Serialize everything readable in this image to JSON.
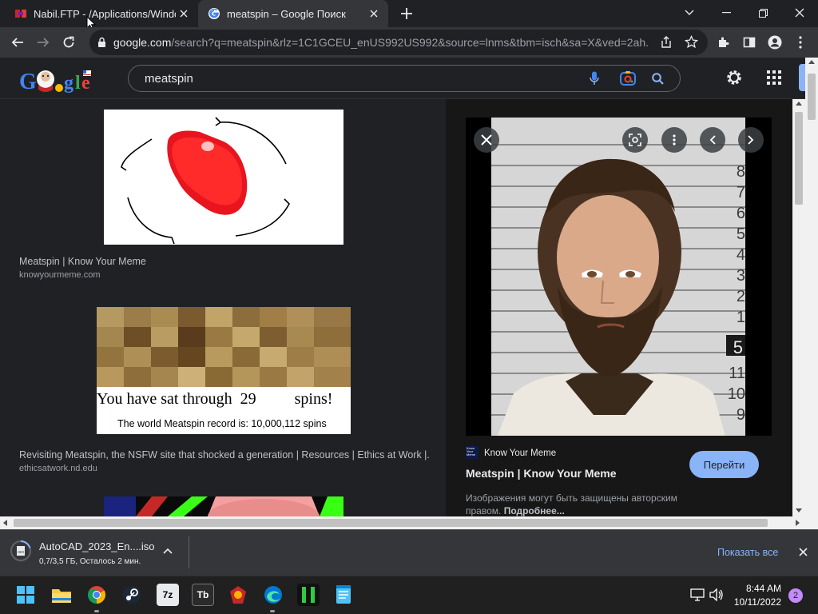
{
  "browser": {
    "tabs": [
      {
        "title": "Nabil.FTP - /Applications/Windows",
        "favicon": "ftp-icon"
      },
      {
        "title": "meatspin – Google Поиск",
        "favicon": "google-icon",
        "active": true
      }
    ],
    "url_host": "google.com",
    "url_rest": "/search?q=meatspin&rlz=1C1GCEU_enUS992US992&source=lnms&tbm=isch&sa=X&ved=2ah..."
  },
  "search": {
    "query": "meatspin"
  },
  "results": [
    {
      "title": "Meatspin | Know Your Meme",
      "source": "knowyourmeme.com"
    },
    {
      "title": "Revisiting Meatspin, the NSFW site that shocked a generation | Resources | Ethics at Work |...",
      "source": "ethicsatwork.nd.edu",
      "image_text_line1": "You have sat through",
      "image_text_count": "29",
      "image_text_suffix": "spins!",
      "image_text_line2": "The world Meatspin record is: 10,000,112 spins"
    }
  ],
  "panel": {
    "source_name": "Know Your Meme",
    "source_logo_text": "Know Your Meme",
    "title": "Meatspin | Know Your Meme",
    "visit_label": "Перейти",
    "copyright_text": "Изображения могут быть защищены авторским правом.",
    "copyright_more": "Подробнее...",
    "mugshot_height_marks": [
      "8",
      "7",
      "6",
      "5",
      "4",
      "3",
      "2",
      "1",
      "5",
      "11",
      "10",
      "9"
    ]
  },
  "download": {
    "filename": "AutoCAD_2023_En....iso",
    "progress_text": "0,7/3,5 ГБ, Осталось 2 мин.",
    "progress": 0.2,
    "file_icon_text": "ISO",
    "show_all_label": "Показать все"
  },
  "taskbar": {
    "time": "8:44 AM",
    "date": "10/11/2022",
    "notification_count": "2",
    "app_7z_label": "7z",
    "app_tb_label": "Tb"
  },
  "colors": {
    "accent": "#8ab4f8",
    "page_bg": "#202124",
    "panel_bg": "#171717"
  }
}
